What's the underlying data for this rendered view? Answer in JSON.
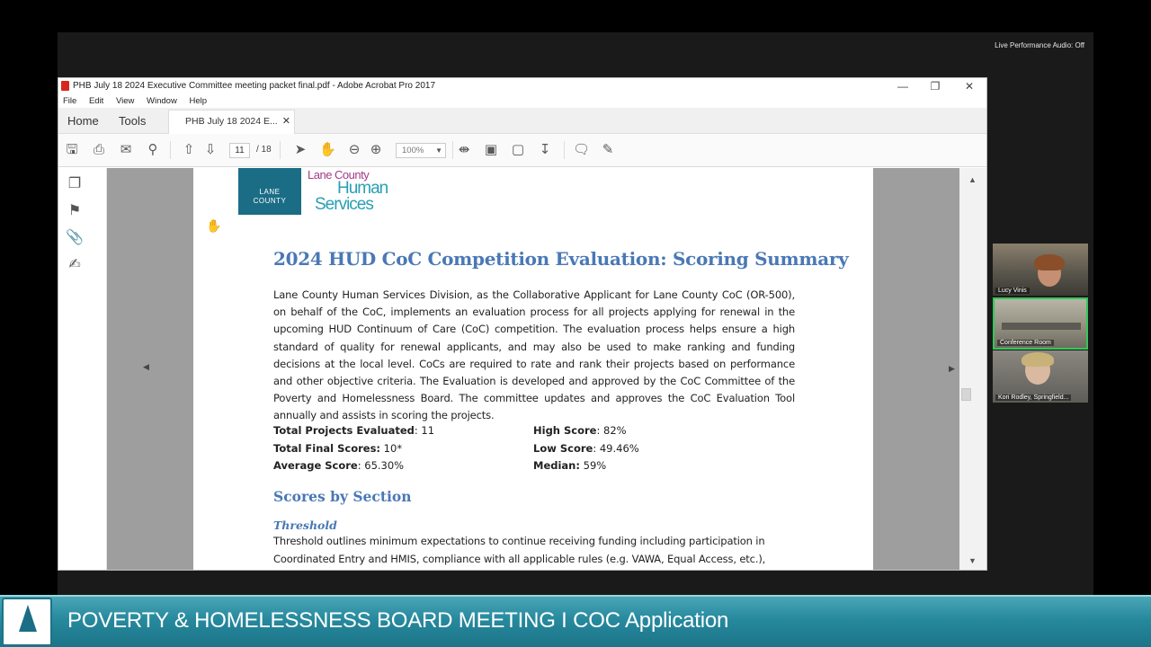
{
  "stream": {
    "live_audio": "Live Performance Audio: Off",
    "banner_text": "POVERTY & HOMELESSNESS BOARD MEETING I COC Application"
  },
  "acrobat": {
    "window_title": "PHB July 18 2024 Executive Committee meeting packet final.pdf - Adobe Acrobat Pro 2017",
    "menu": [
      "File",
      "Edit",
      "View",
      "Window",
      "Help"
    ],
    "tabs": {
      "home": "Home",
      "tools": "Tools",
      "document": "PHB July 18 2024 E..."
    },
    "toolbar": {
      "current_page": "11",
      "total_pages": "/ 18",
      "zoom": "100%"
    }
  },
  "document": {
    "logo": {
      "line1": "Lane County",
      "line2": "Human",
      "line3": "Services",
      "badge": "LANE\nCOUNTY\nOREGON"
    },
    "title": "2024 HUD CoC Competition Evaluation: Scoring Summary",
    "intro": "Lane County Human Services Division, as the Collaborative Applicant for Lane County CoC (OR-500), on behalf of the CoC, implements an evaluation process for all projects applying for renewal in the upcoming HUD Continuum of Care (CoC) competition. The evaluation process helps ensure a high standard of quality for renewal applicants, and may also be used to make ranking and funding decisions at the local level. CoCs are required to rate and rank their projects based on performance and other objective criteria. The Evaluation is developed and approved by the CoC Committee of the Poverty and Homelessness Board. The committee updates and approves the CoC Evaluation Tool annually and assists in scoring the projects.",
    "stats": {
      "total_projects_label": "Total Projects Evaluated",
      "total_projects_value": ": 11",
      "total_final_label": "Total Final Scores:",
      "total_final_value": " 10*",
      "average_label": "Average Score",
      "average_value": ": 65.30%",
      "high_label": "High Score",
      "high_value": ": 82%",
      "low_label": "Low Score",
      "low_value": ": 49.46%",
      "median_label": "Median:",
      "median_value": " 59%"
    },
    "section_heading": "Scores by Section",
    "subheading": "Threshold",
    "threshold_text": "Threshold outlines minimum expectations to continue receiving funding including participation in Coordinated Entry and HMIS, compliance with all applicable rules (e.g. VAWA, Equal Access, etc.), having"
  },
  "participants": [
    {
      "name": "Lucy Vinis"
    },
    {
      "name": "Conference Room"
    },
    {
      "name": "Kori Rodley, Springfield..."
    }
  ]
}
